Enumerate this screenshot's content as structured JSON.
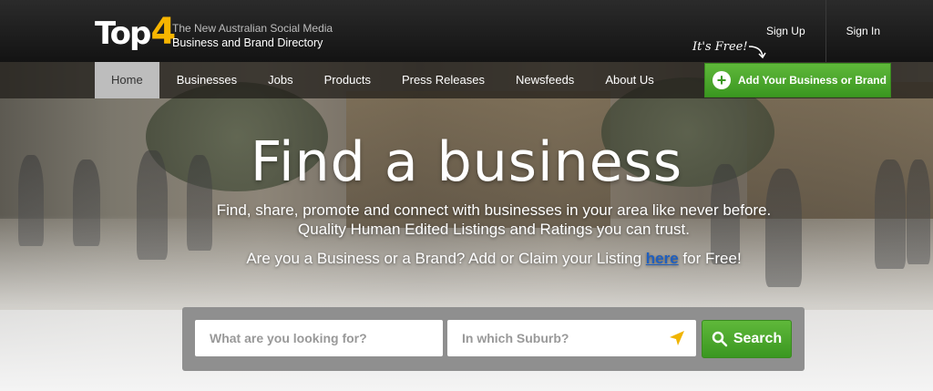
{
  "brand": {
    "logo_text": "Top",
    "logo_number": "4",
    "tagline_line1": "The New Australian Social Media",
    "tagline_line2": "Business and Brand Directory"
  },
  "auth": {
    "sign_up": "Sign Up",
    "sign_in": "Sign In"
  },
  "nav": {
    "items": [
      {
        "label": "Home",
        "active": true
      },
      {
        "label": "Businesses"
      },
      {
        "label": "Jobs"
      },
      {
        "label": "Products"
      },
      {
        "label": "Press Releases"
      },
      {
        "label": "Newsfeeds"
      },
      {
        "label": "About Us"
      }
    ]
  },
  "cta": {
    "free_note": "It's Free!",
    "add_label": "Add Your Business or Brand"
  },
  "hero": {
    "title": "Find a business",
    "line1": "Find, share, promote and connect with businesses in your area like never before.",
    "line2": "Quality Human Edited Listings and Ratings you can trust.",
    "line3_before": "Are you a Business or a Brand? Add or Claim your Listing ",
    "line3_link": "here",
    "line3_after": " for Free!"
  },
  "search": {
    "what_placeholder": "What are you looking for?",
    "where_placeholder": "In which Suburb?",
    "button_label": "Search"
  },
  "colors": {
    "accent_green": "#3a9720",
    "logo_yellow": "#f7b500",
    "link_blue": "#1f5fbf"
  }
}
